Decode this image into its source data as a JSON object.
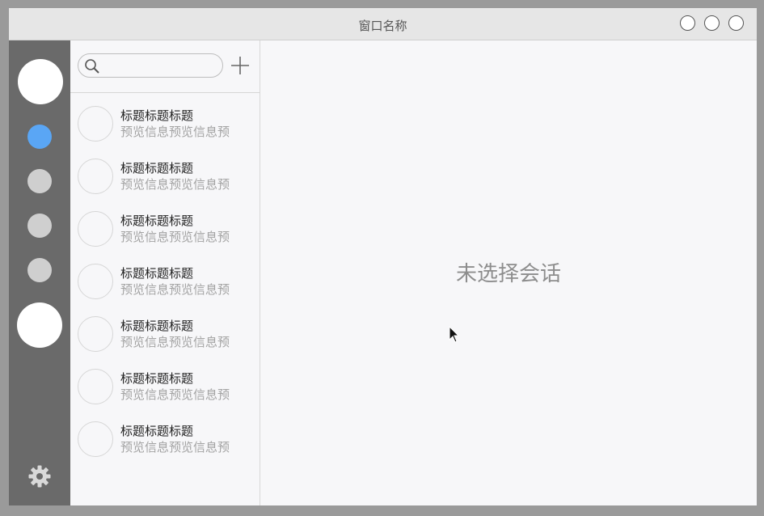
{
  "window": {
    "title": "窗口名称",
    "controls": [
      "circle-button",
      "circle-button",
      "circle-button"
    ]
  },
  "sidebar": {
    "items": [
      {
        "name": "user-avatar",
        "active": false
      },
      {
        "name": "nav-item-1",
        "active": true
      },
      {
        "name": "nav-item-2",
        "active": false
      },
      {
        "name": "nav-item-3",
        "active": false
      },
      {
        "name": "nav-item-4",
        "active": false
      },
      {
        "name": "nav-item-5",
        "active": false
      }
    ],
    "settings_icon": "gear-icon"
  },
  "search": {
    "placeholder": "",
    "icon": "search-icon",
    "add_icon": "plus-icon"
  },
  "conversations": [
    {
      "title": "标题标题标题",
      "preview": "预览信息预览信息预"
    },
    {
      "title": "标题标题标题",
      "preview": "预览信息预览信息预"
    },
    {
      "title": "标题标题标题",
      "preview": "预览信息预览信息预"
    },
    {
      "title": "标题标题标题",
      "preview": "预览信息预览信息预"
    },
    {
      "title": "标题标题标题",
      "preview": "预览信息预览信息预"
    },
    {
      "title": "标题标题标题",
      "preview": "预览信息预览信息预"
    },
    {
      "title": "标题标题标题",
      "preview": "预览信息预览信息预"
    }
  ],
  "main": {
    "empty_text": "未选择会话"
  },
  "colors": {
    "sidebar_bg": "#6a6a6a",
    "active_nav": "#5aa6f5",
    "inactive_nav": "#cfcfcf"
  }
}
